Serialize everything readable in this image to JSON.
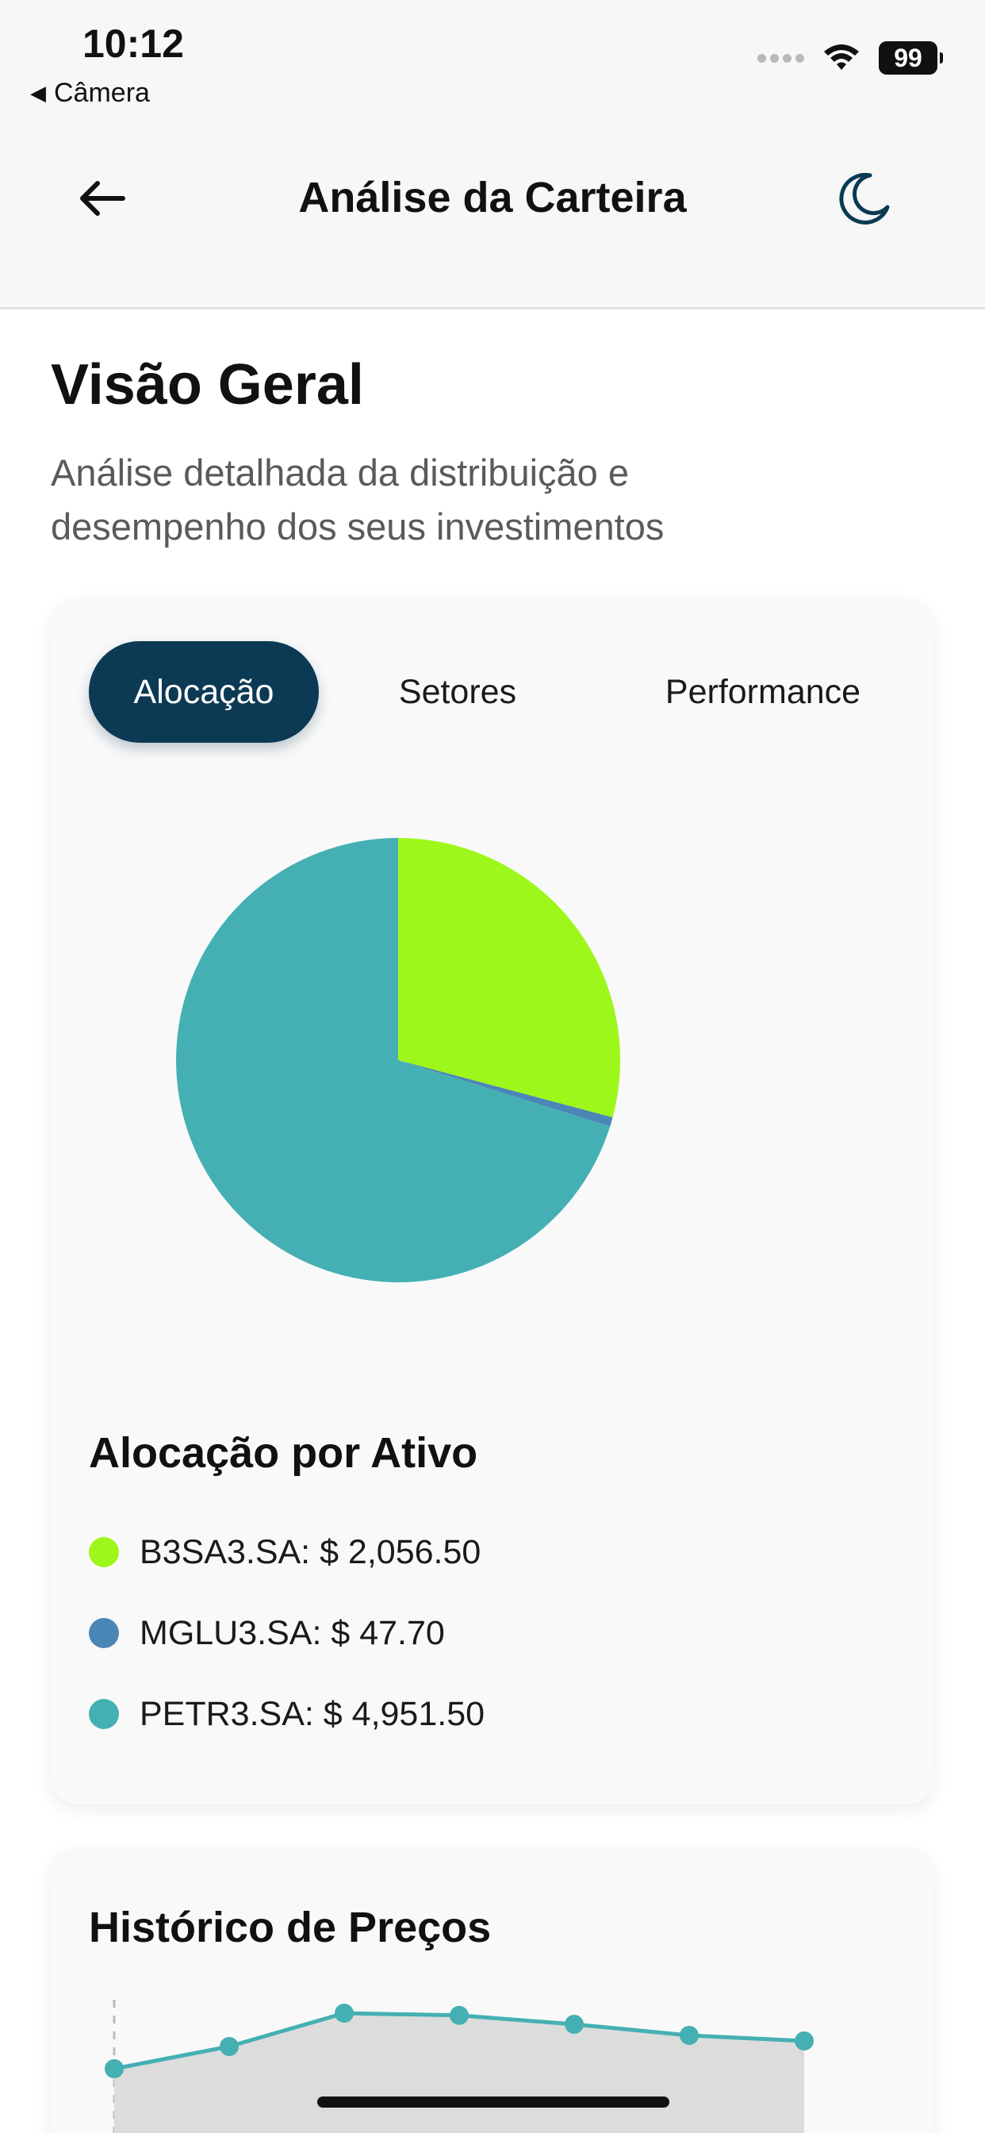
{
  "status_bar": {
    "time": "10:12",
    "back_label": "Câmera",
    "battery": "99"
  },
  "nav": {
    "title": "Análise da Carteira"
  },
  "header": {
    "title": "Visão Geral",
    "subtitle_line1": "Análise detalhada da distribuição e",
    "subtitle_line2": "desempenho dos seus investimentos"
  },
  "tabs": [
    {
      "label": "Alocação",
      "active": true
    },
    {
      "label": "Setores",
      "active": false
    },
    {
      "label": "Performance",
      "active": false
    }
  ],
  "allocation": {
    "title": "Alocação por Ativo",
    "items": [
      {
        "label": "B3SA3.SA: $ 2,056.50",
        "value": 2056.5,
        "color": "#9ef71a"
      },
      {
        "label": "MGLU3.SA: $ 47.70",
        "value": 47.7,
        "color": "#4a86b6"
      },
      {
        "label": "PETR3.SA: $ 4,951.50",
        "value": 4951.5,
        "color": "#45b0b3"
      }
    ]
  },
  "chart_data": [
    {
      "type": "pie",
      "labels": [
        "B3SA3.SA",
        "MGLU3.SA",
        "PETR3.SA"
      ],
      "values": [
        2056.5,
        47.7,
        4951.5
      ],
      "colors": [
        "#9ef71a",
        "#4a86b6",
        "#45b0b3"
      ]
    },
    {
      "type": "area",
      "title": "Histórico de Preços",
      "values": [
        0.45,
        0.65,
        0.95,
        0.93,
        0.85,
        0.75,
        0.7
      ],
      "color": "#45b0b3"
    }
  ],
  "colors": {
    "accent": "#0c3a55",
    "tab_active_bg": "#0c3a55"
  },
  "icons": {
    "back": "arrow-left-icon",
    "theme": "moon-icon",
    "wifi": "wifi-icon"
  }
}
